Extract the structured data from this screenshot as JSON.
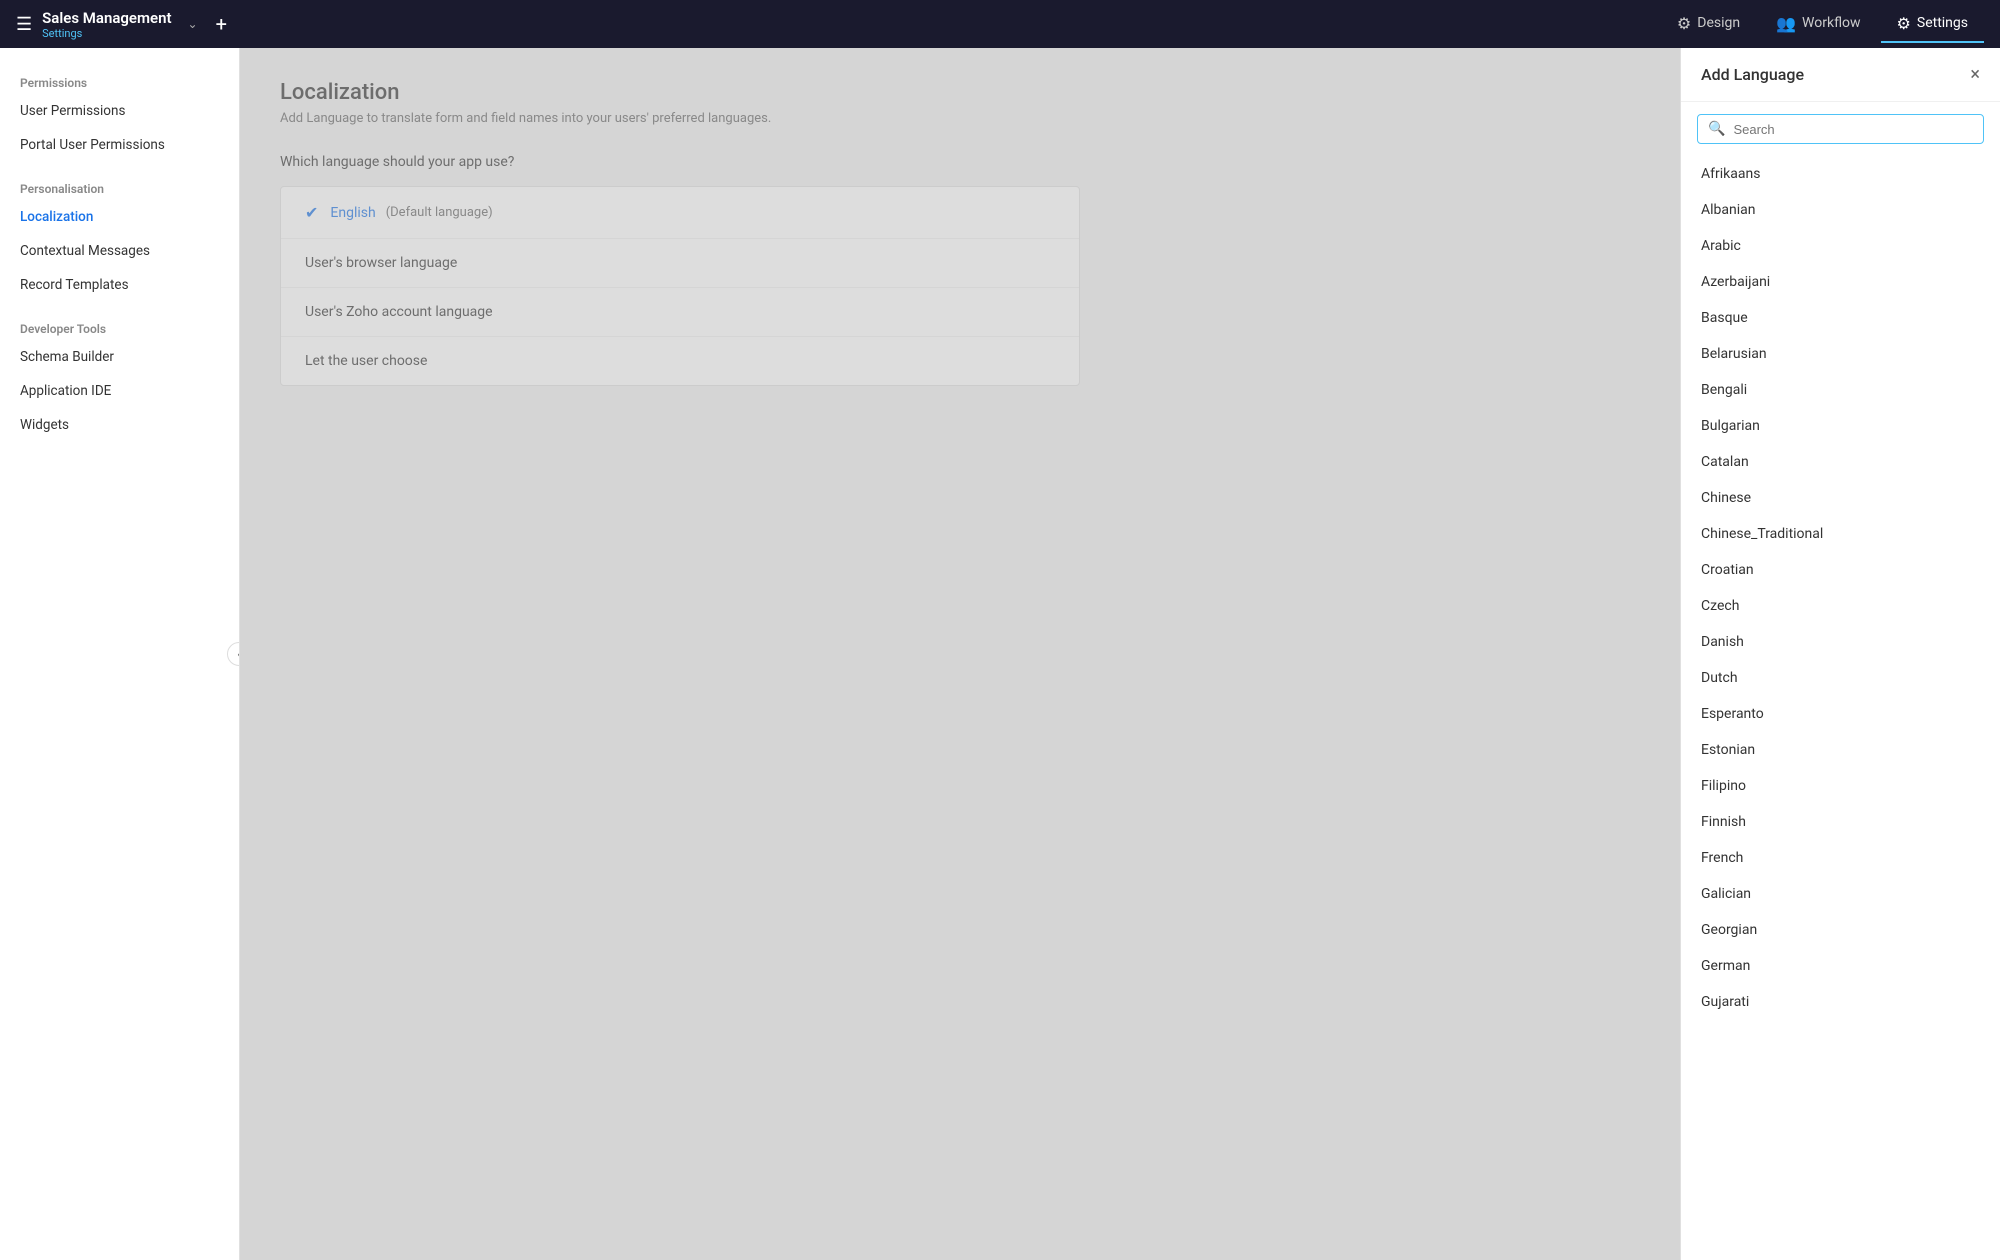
{
  "topNav": {
    "appTitle": "Sales Management",
    "appSubtitle": "Settings",
    "tabs": [
      {
        "id": "design",
        "label": "Design",
        "icon": "⚙"
      },
      {
        "id": "workflow",
        "label": "Workflow",
        "icon": "👥"
      },
      {
        "id": "settings",
        "label": "Settings",
        "icon": "⚙",
        "active": true
      }
    ],
    "hamburgerLabel": "☰",
    "addLabel": "+",
    "chevronLabel": "⌄"
  },
  "sidebar": {
    "sections": [
      {
        "id": "permissions",
        "label": "Permissions",
        "items": [
          {
            "id": "user-permissions",
            "label": "User Permissions",
            "active": false
          },
          {
            "id": "portal-user-permissions",
            "label": "Portal User Permissions",
            "active": false
          }
        ]
      },
      {
        "id": "personalisation",
        "label": "Personalisation",
        "items": [
          {
            "id": "localization",
            "label": "Localization",
            "active": true
          },
          {
            "id": "contextual-messages",
            "label": "Contextual Messages",
            "active": false
          },
          {
            "id": "record-templates",
            "label": "Record Templates",
            "active": false
          }
        ]
      },
      {
        "id": "developer-tools",
        "label": "Developer Tools",
        "items": [
          {
            "id": "schema-builder",
            "label": "Schema Builder",
            "active": false
          },
          {
            "id": "application-ide",
            "label": "Application IDE",
            "active": false
          },
          {
            "id": "widgets",
            "label": "Widgets",
            "active": false
          }
        ]
      }
    ],
    "collapseIcon": "‹"
  },
  "content": {
    "title": "Localization",
    "subtitle": "Add Language to translate form and field names into your users' preferred languages.",
    "sectionLabel": "Which language should your app use?",
    "languageOptions": [
      {
        "id": "english",
        "label": "English",
        "badge": "(Default language)",
        "selected": true
      },
      {
        "id": "browser-language",
        "label": "User's browser language",
        "selected": false
      },
      {
        "id": "zoho-language",
        "label": "User's Zoho account language",
        "selected": false
      },
      {
        "id": "user-choose",
        "label": "Let the user choose",
        "selected": false
      }
    ]
  },
  "addLanguagePanel": {
    "title": "Add Language",
    "closeIcon": "×",
    "search": {
      "placeholder": "Search",
      "icon": "🔍"
    },
    "languages": [
      "Afrikaans",
      "Albanian",
      "Arabic",
      "Azerbaijani",
      "Basque",
      "Belarusian",
      "Bengali",
      "Bulgarian",
      "Catalan",
      "Chinese",
      "Chinese_Traditional",
      "Croatian",
      "Czech",
      "Danish",
      "Dutch",
      "Esperanto",
      "Estonian",
      "Filipino",
      "Finnish",
      "French",
      "Galician",
      "Georgian",
      "German",
      "Gujarati"
    ]
  }
}
